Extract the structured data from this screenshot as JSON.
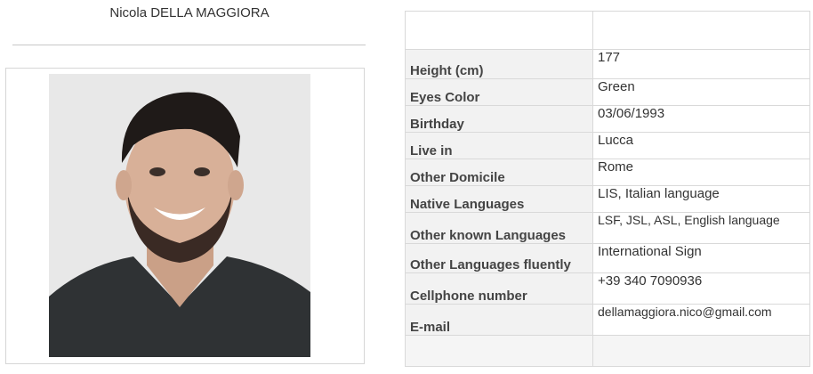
{
  "profile": {
    "name": "Nicola DELLA MAGGIORA"
  },
  "details": [
    {
      "label": "Height (cm)",
      "value": "177"
    },
    {
      "label": "Eyes Color",
      "value": "Green"
    },
    {
      "label": "Birthday",
      "value": "03/06/1993"
    },
    {
      "label": "Live in",
      "value": "Lucca"
    },
    {
      "label": "Other Domicile",
      "value": "Rome"
    },
    {
      "label": "Native Languages",
      "value": "LIS, Italian language"
    },
    {
      "label": "Other known Languages",
      "value": "LSF, JSL, ASL, English language"
    },
    {
      "label": "Other Languages fluently",
      "value": "International Sign"
    },
    {
      "label": "Cellphone number",
      "value": "+39 340 7090936"
    },
    {
      "label": "E-mail",
      "value": "dellamaggiora.nico@gmail.com"
    }
  ]
}
